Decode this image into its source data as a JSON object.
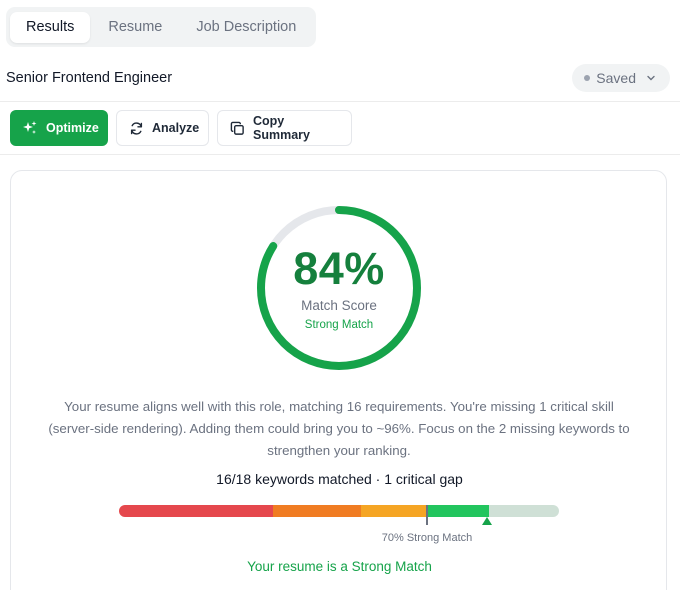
{
  "tabs": [
    {
      "label": "Results",
      "active": true
    },
    {
      "label": "Resume",
      "active": false
    },
    {
      "label": "Job Description",
      "active": false
    }
  ],
  "job_title": "Senior Frontend Engineer",
  "save_status": {
    "label": "Saved",
    "icon": "chevron-down-icon"
  },
  "toolbar": {
    "optimize_label": "Optimize",
    "analyze_label": "Analyze",
    "copy_label": "Copy Summary"
  },
  "score": {
    "value": "84%",
    "percent": 84,
    "label": "Match Score",
    "verdict": "Strong Match"
  },
  "summary": "Your resume aligns well with this role, matching 16 requirements. You're missing 1 critical skill (server-side rendering). Adding them could bring you to ~96%. Focus on the 2 missing keywords to strengthen your ranking.",
  "keywords_line": "16/18 keywords matched · 1 critical gap",
  "match_bar": {
    "threshold_label": "70% Strong Match",
    "threshold_percent": 70,
    "current_percent": 84,
    "segments": [
      {
        "from": 0,
        "to": 35,
        "color": "#e5484d"
      },
      {
        "from": 35,
        "to": 55,
        "color": "#f07c22"
      },
      {
        "from": 55,
        "to": 70,
        "color": "#f5a524"
      },
      {
        "from": 70,
        "to": 84,
        "color": "#22c55e"
      },
      {
        "from": 84,
        "to": 100,
        "color": "#cfe0d6"
      }
    ]
  },
  "result_line": "Your resume is a Strong Match",
  "colors": {
    "accent": "#16a34a",
    "score_text": "#15803d",
    "track": "#e5e7eb"
  }
}
